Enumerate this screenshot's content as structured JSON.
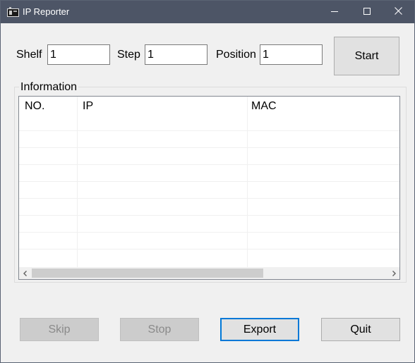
{
  "window": {
    "title": "IP Reporter"
  },
  "form": {
    "shelf_label": "Shelf",
    "shelf_value": "1",
    "step_label": "Step",
    "step_value": "1",
    "position_label": "Position",
    "position_value": "1",
    "start_label": "Start"
  },
  "information": {
    "group_label": "Information",
    "columns": [
      "NO.",
      "IP",
      "MAC"
    ],
    "rows": []
  },
  "buttons": {
    "skip_label": "Skip",
    "stop_label": "Stop",
    "export_label": "Export",
    "quit_label": "Quit"
  },
  "icons": {
    "app": "app-icon",
    "minimize": "minimize-icon",
    "maximize": "maximize-icon",
    "close": "close-icon",
    "scroll_left": "chevron-left-icon",
    "scroll_right": "chevron-right-icon"
  },
  "colors": {
    "titlebar": "#4d5566",
    "window_bg": "#f0f0f0",
    "focus_border": "#0078d7"
  }
}
